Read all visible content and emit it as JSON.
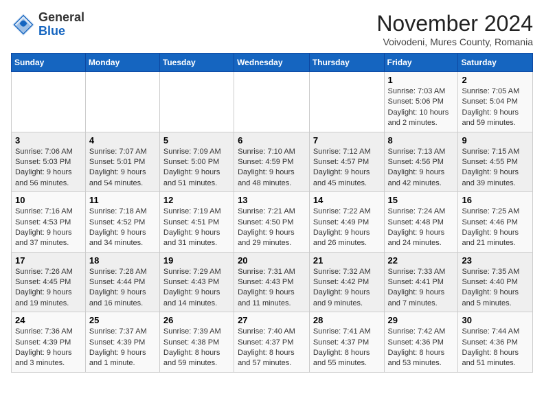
{
  "header": {
    "logo_general": "General",
    "logo_blue": "Blue",
    "month_title": "November 2024",
    "subtitle": "Voivodeni, Mures County, Romania"
  },
  "weekdays": [
    "Sunday",
    "Monday",
    "Tuesday",
    "Wednesday",
    "Thursday",
    "Friday",
    "Saturday"
  ],
  "weeks": [
    [
      {
        "day": "",
        "info": ""
      },
      {
        "day": "",
        "info": ""
      },
      {
        "day": "",
        "info": ""
      },
      {
        "day": "",
        "info": ""
      },
      {
        "day": "",
        "info": ""
      },
      {
        "day": "1",
        "info": "Sunrise: 7:03 AM\nSunset: 5:06 PM\nDaylight: 10 hours and 2 minutes."
      },
      {
        "day": "2",
        "info": "Sunrise: 7:05 AM\nSunset: 5:04 PM\nDaylight: 9 hours and 59 minutes."
      }
    ],
    [
      {
        "day": "3",
        "info": "Sunrise: 7:06 AM\nSunset: 5:03 PM\nDaylight: 9 hours and 56 minutes."
      },
      {
        "day": "4",
        "info": "Sunrise: 7:07 AM\nSunset: 5:01 PM\nDaylight: 9 hours and 54 minutes."
      },
      {
        "day": "5",
        "info": "Sunrise: 7:09 AM\nSunset: 5:00 PM\nDaylight: 9 hours and 51 minutes."
      },
      {
        "day": "6",
        "info": "Sunrise: 7:10 AM\nSunset: 4:59 PM\nDaylight: 9 hours and 48 minutes."
      },
      {
        "day": "7",
        "info": "Sunrise: 7:12 AM\nSunset: 4:57 PM\nDaylight: 9 hours and 45 minutes."
      },
      {
        "day": "8",
        "info": "Sunrise: 7:13 AM\nSunset: 4:56 PM\nDaylight: 9 hours and 42 minutes."
      },
      {
        "day": "9",
        "info": "Sunrise: 7:15 AM\nSunset: 4:55 PM\nDaylight: 9 hours and 39 minutes."
      }
    ],
    [
      {
        "day": "10",
        "info": "Sunrise: 7:16 AM\nSunset: 4:53 PM\nDaylight: 9 hours and 37 minutes."
      },
      {
        "day": "11",
        "info": "Sunrise: 7:18 AM\nSunset: 4:52 PM\nDaylight: 9 hours and 34 minutes."
      },
      {
        "day": "12",
        "info": "Sunrise: 7:19 AM\nSunset: 4:51 PM\nDaylight: 9 hours and 31 minutes."
      },
      {
        "day": "13",
        "info": "Sunrise: 7:21 AM\nSunset: 4:50 PM\nDaylight: 9 hours and 29 minutes."
      },
      {
        "day": "14",
        "info": "Sunrise: 7:22 AM\nSunset: 4:49 PM\nDaylight: 9 hours and 26 minutes."
      },
      {
        "day": "15",
        "info": "Sunrise: 7:24 AM\nSunset: 4:48 PM\nDaylight: 9 hours and 24 minutes."
      },
      {
        "day": "16",
        "info": "Sunrise: 7:25 AM\nSunset: 4:46 PM\nDaylight: 9 hours and 21 minutes."
      }
    ],
    [
      {
        "day": "17",
        "info": "Sunrise: 7:26 AM\nSunset: 4:45 PM\nDaylight: 9 hours and 19 minutes."
      },
      {
        "day": "18",
        "info": "Sunrise: 7:28 AM\nSunset: 4:44 PM\nDaylight: 9 hours and 16 minutes."
      },
      {
        "day": "19",
        "info": "Sunrise: 7:29 AM\nSunset: 4:43 PM\nDaylight: 9 hours and 14 minutes."
      },
      {
        "day": "20",
        "info": "Sunrise: 7:31 AM\nSunset: 4:43 PM\nDaylight: 9 hours and 11 minutes."
      },
      {
        "day": "21",
        "info": "Sunrise: 7:32 AM\nSunset: 4:42 PM\nDaylight: 9 hours and 9 minutes."
      },
      {
        "day": "22",
        "info": "Sunrise: 7:33 AM\nSunset: 4:41 PM\nDaylight: 9 hours and 7 minutes."
      },
      {
        "day": "23",
        "info": "Sunrise: 7:35 AM\nSunset: 4:40 PM\nDaylight: 9 hours and 5 minutes."
      }
    ],
    [
      {
        "day": "24",
        "info": "Sunrise: 7:36 AM\nSunset: 4:39 PM\nDaylight: 9 hours and 3 minutes."
      },
      {
        "day": "25",
        "info": "Sunrise: 7:37 AM\nSunset: 4:39 PM\nDaylight: 9 hours and 1 minute."
      },
      {
        "day": "26",
        "info": "Sunrise: 7:39 AM\nSunset: 4:38 PM\nDaylight: 8 hours and 59 minutes."
      },
      {
        "day": "27",
        "info": "Sunrise: 7:40 AM\nSunset: 4:37 PM\nDaylight: 8 hours and 57 minutes."
      },
      {
        "day": "28",
        "info": "Sunrise: 7:41 AM\nSunset: 4:37 PM\nDaylight: 8 hours and 55 minutes."
      },
      {
        "day": "29",
        "info": "Sunrise: 7:42 AM\nSunset: 4:36 PM\nDaylight: 8 hours and 53 minutes."
      },
      {
        "day": "30",
        "info": "Sunrise: 7:44 AM\nSunset: 4:36 PM\nDaylight: 8 hours and 51 minutes."
      }
    ]
  ]
}
